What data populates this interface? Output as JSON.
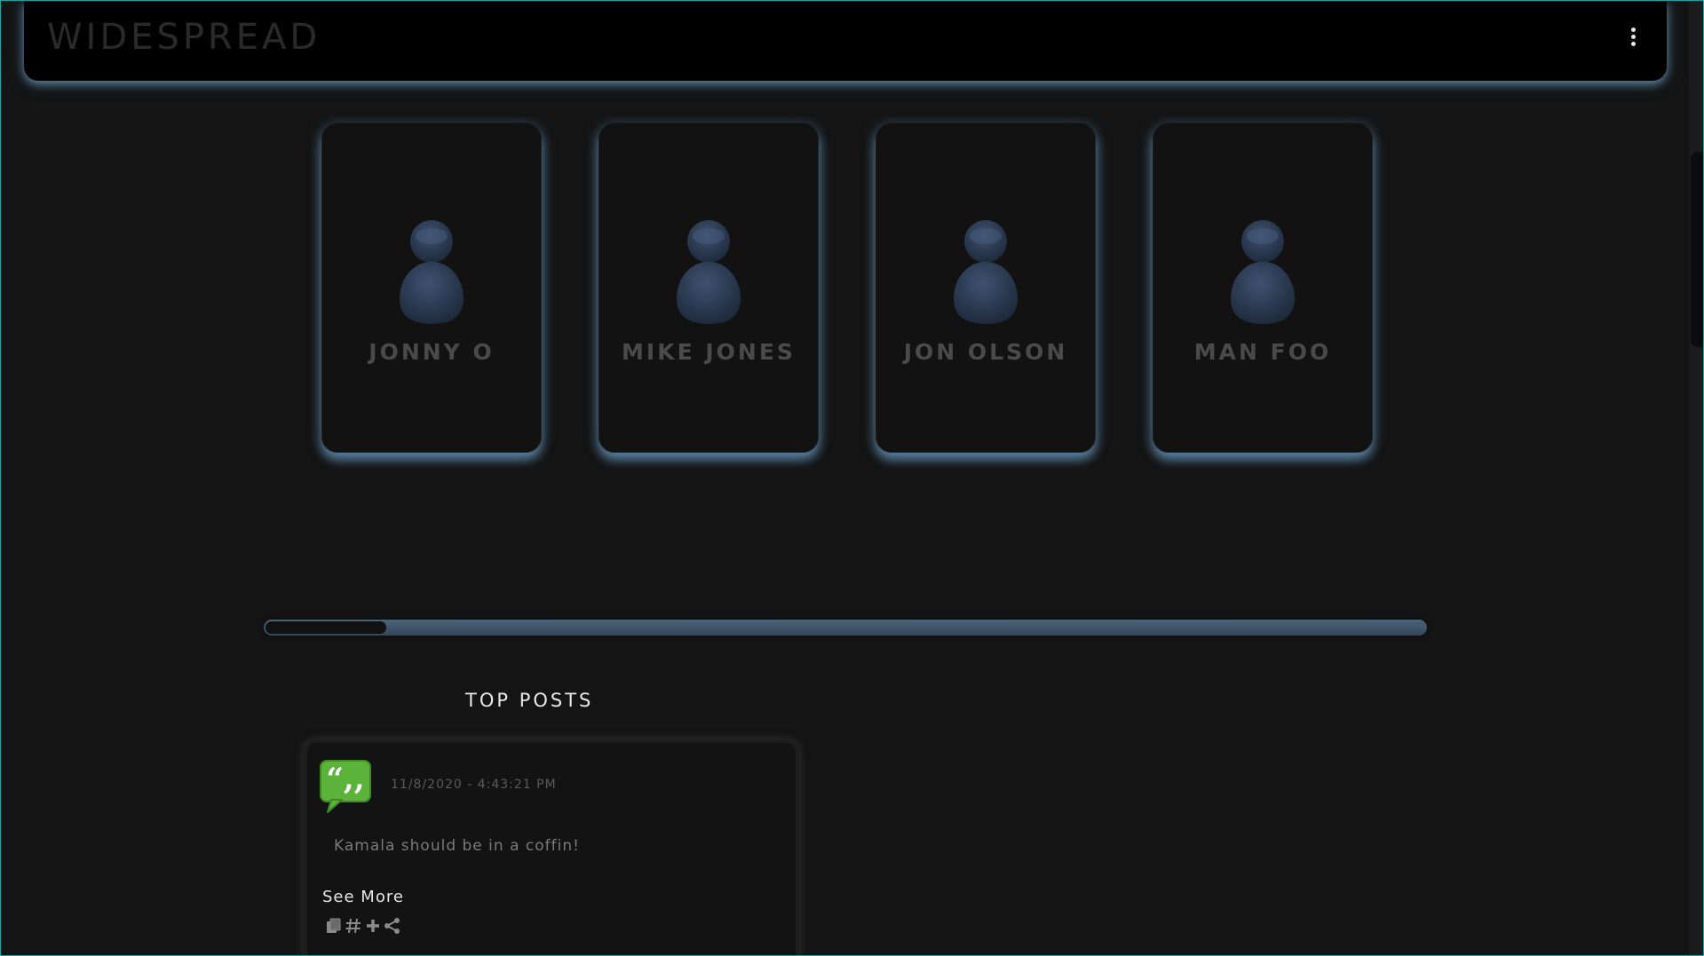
{
  "header": {
    "brand": "WIDESPREAD",
    "menu_icon": "more-vertical-icon"
  },
  "users": [
    {
      "name": "JONNY O",
      "avatar_icon": "user-avatar-icon"
    },
    {
      "name": "MIKE JONES",
      "avatar_icon": "user-avatar-icon"
    },
    {
      "name": "JON OLSON",
      "avatar_icon": "user-avatar-icon"
    },
    {
      "name": "MAN FOO",
      "avatar_icon": "user-avatar-icon"
    }
  ],
  "colors": {
    "glow": "#6ea0c8",
    "avatar": "#2a3a52",
    "quote_icon_green": "#5cb33a",
    "frame_border": "#1aa3a3"
  },
  "top_posts": {
    "title": "TOP POSTS",
    "posts": [
      {
        "icon": "quote-bubble-icon",
        "timestamp": "11/8/2020 - 4:43:21 PM",
        "text": "Kamala should be in a coffin!",
        "see_more": "See More",
        "actions": [
          "copy-icon",
          "hashtag-icon",
          "plus-icon",
          "share-icon"
        ]
      }
    ]
  }
}
